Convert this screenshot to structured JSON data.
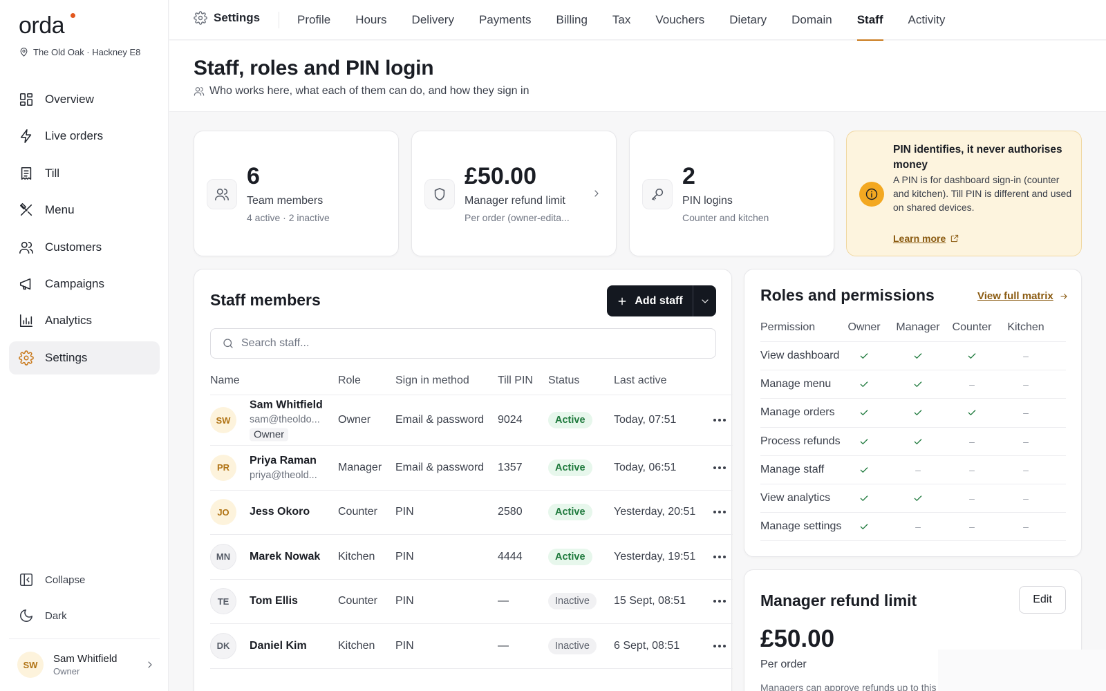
{
  "brand": {
    "name": "orda",
    "location": "The Old Oak · Hackney E8",
    "accent": "#c9791b",
    "dot": "#e2571e"
  },
  "sidebar": {
    "items": [
      {
        "label": "Overview",
        "icon": "grid-icon"
      },
      {
        "label": "Live orders",
        "icon": "lightning-icon"
      },
      {
        "label": "Till",
        "icon": "receipt-icon"
      },
      {
        "label": "Menu",
        "icon": "utensils-icon"
      },
      {
        "label": "Customers",
        "icon": "users-icon"
      },
      {
        "label": "Campaigns",
        "icon": "megaphone-icon"
      },
      {
        "label": "Analytics",
        "icon": "bar-chart-icon"
      },
      {
        "label": "Settings",
        "icon": "gear-icon",
        "active": true
      }
    ],
    "collapse": "Collapse",
    "dark": "Dark",
    "user": {
      "initials": "SW",
      "name": "Sam Whitfield",
      "role": "Owner"
    }
  },
  "topbar": {
    "crumb": "Settings",
    "tabs": [
      "Profile",
      "Hours",
      "Delivery",
      "Payments",
      "Billing",
      "Tax",
      "Vouchers",
      "Dietary",
      "Domain",
      "Staff",
      "Activity"
    ],
    "active_tab": "Staff"
  },
  "header": {
    "title": "Staff, roles and PIN login",
    "subtitle": "Who works here, what each of them can do, and how they sign in"
  },
  "stats": [
    {
      "value": "6",
      "label": "Team members",
      "sub": "4 active · 2 inactive",
      "icon": "users-icon"
    },
    {
      "value": "£50.00",
      "label": "Manager refund limit",
      "sub": "Per order (owner-edita...",
      "icon": "shield-icon"
    },
    {
      "value": "2",
      "label": "PIN logins",
      "sub": "Counter and kitchen",
      "icon": "key-icon"
    }
  ],
  "info": {
    "title": "PIN identifies, it never authorises money",
    "body": "A PIN is for dashboard sign-in (counter and kitchen). Till PIN is different and used on shared devices.",
    "link": "Learn more"
  },
  "staff": {
    "title": "Staff members",
    "add_label": "Add staff",
    "search_placeholder": "Search staff...",
    "columns": [
      "Name",
      "Role",
      "Sign in method",
      "Till PIN",
      "Status",
      "Last active"
    ],
    "rows": [
      {
        "initials": "SW",
        "name": "Sam Whitfield",
        "email": "sam@theoldo...",
        "tag": "Owner",
        "role": "Owner",
        "method": "Email & password",
        "pin": "9024",
        "status": "Active",
        "last": "Today, 07:51",
        "tone": "warm"
      },
      {
        "initials": "PR",
        "name": "Priya Raman",
        "email": "priya@theold...",
        "tag": "",
        "role": "Manager",
        "method": "Email & password",
        "pin": "1357",
        "status": "Active",
        "last": "Today, 06:51",
        "tone": "warm"
      },
      {
        "initials": "JO",
        "name": "Jess Okoro",
        "email": "",
        "tag": "",
        "role": "Counter",
        "method": "PIN",
        "pin": "2580",
        "status": "Active",
        "last": "Yesterday, 20:51",
        "tone": "warm"
      },
      {
        "initials": "MN",
        "name": "Marek Nowak",
        "email": "",
        "tag": "",
        "role": "Kitchen",
        "method": "PIN",
        "pin": "4444",
        "status": "Active",
        "last": "Yesterday, 19:51",
        "tone": "grey"
      },
      {
        "initials": "TE",
        "name": "Tom Ellis",
        "email": "",
        "tag": "",
        "role": "Counter",
        "method": "PIN",
        "pin": "—",
        "status": "Inactive",
        "last": "15 Sept, 08:51",
        "tone": "grey"
      },
      {
        "initials": "DK",
        "name": "Daniel Kim",
        "email": "",
        "tag": "",
        "role": "Kitchen",
        "method": "PIN",
        "pin": "—",
        "status": "Inactive",
        "last": "6 Sept, 08:51",
        "tone": "grey"
      }
    ]
  },
  "roles": {
    "title": "Roles and permissions",
    "link": "View full matrix",
    "columns": [
      "Permission",
      "Owner",
      "Manager",
      "Counter",
      "Kitchen"
    ],
    "dash": "–",
    "rows": [
      {
        "name": "View dashboard",
        "perms": [
          true,
          true,
          true,
          false
        ]
      },
      {
        "name": "Manage menu",
        "perms": [
          true,
          true,
          false,
          false
        ]
      },
      {
        "name": "Manage orders",
        "perms": [
          true,
          true,
          true,
          false
        ]
      },
      {
        "name": "Process refunds",
        "perms": [
          true,
          true,
          false,
          false
        ]
      },
      {
        "name": "Manage staff",
        "perms": [
          true,
          false,
          false,
          false
        ]
      },
      {
        "name": "View analytics",
        "perms": [
          true,
          true,
          false,
          false
        ]
      },
      {
        "name": "Manage settings",
        "perms": [
          true,
          false,
          false,
          false
        ]
      }
    ]
  },
  "refund": {
    "title": "Manager refund limit",
    "edit": "Edit",
    "value": "£50.00",
    "sub": "Per order",
    "desc": "Managers can approve refunds up to this amount."
  }
}
